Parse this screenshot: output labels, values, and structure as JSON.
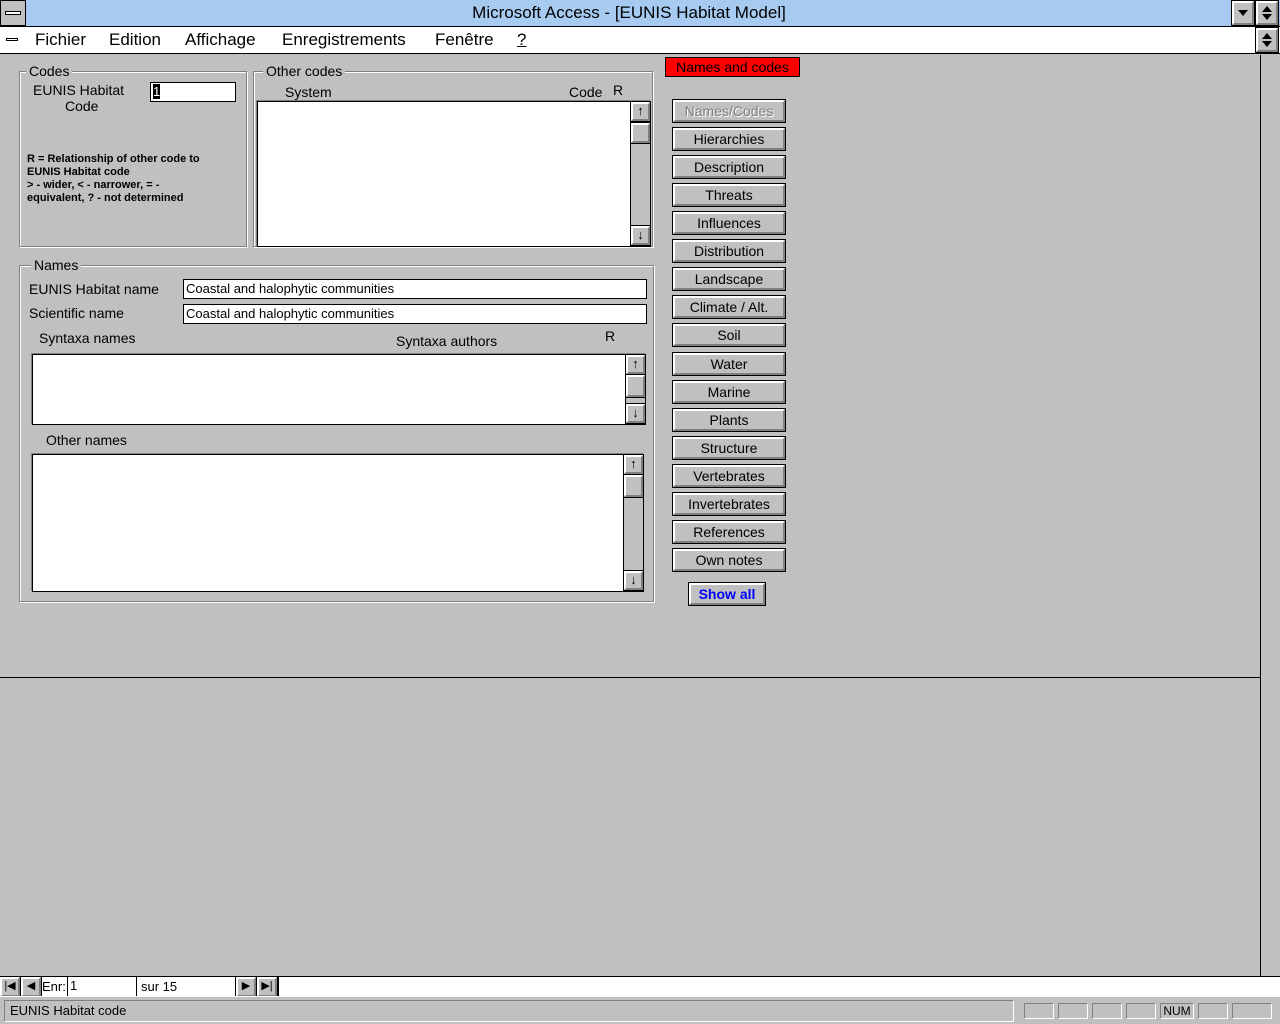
{
  "window": {
    "title": "Microsoft Access - [EUNIS Habitat Model]"
  },
  "menu": {
    "items": [
      "Fichier",
      "Edition",
      "Affichage",
      "Enregistrements",
      "Fenêtre",
      "?"
    ]
  },
  "codes": {
    "group_label": "Codes",
    "eunis_code_label_1": "EUNIS Habitat",
    "eunis_code_label_2": "Code",
    "eunis_code_value": "1",
    "help_line_1": "R = Relationship of other code to",
    "help_line_2": "EUNIS Habitat code",
    "help_line_3": "> - wider, < - narrower, = -",
    "help_line_4": "equivalent, ? - not determined"
  },
  "other_codes": {
    "group_label": "Other codes",
    "col_system": "System",
    "col_code": "Code",
    "col_r": "R"
  },
  "names": {
    "group_label": "Names",
    "eunis_name_label": "EUNIS Habitat name",
    "eunis_name_value": "Coastal and halophytic communities",
    "scientific_name_label": "Scientific name",
    "scientific_name_value": "Coastal and halophytic communities",
    "syntaxa_names_label": "Syntaxa names",
    "syntaxa_authors_label": "Syntaxa authors",
    "syntaxa_r_label": "R",
    "other_names_label": "Other names"
  },
  "badge": {
    "label": "Names and codes",
    "color": "#ff0000"
  },
  "nav_buttons": [
    {
      "label": "Names/Codes",
      "enabled": false
    },
    {
      "label": "Hierarchies",
      "enabled": true
    },
    {
      "label": "Description",
      "enabled": true
    },
    {
      "label": "Threats",
      "enabled": true
    },
    {
      "label": "Influences",
      "enabled": true
    },
    {
      "label": "Distribution",
      "enabled": true
    },
    {
      "label": "Landscape",
      "enabled": true
    },
    {
      "label": "Climate / Alt.",
      "enabled": true
    },
    {
      "label": "Soil",
      "enabled": true
    },
    {
      "label": "Water",
      "enabled": true
    },
    {
      "label": "Marine",
      "enabled": true
    },
    {
      "label": "Plants",
      "enabled": true
    },
    {
      "label": "Structure",
      "enabled": true
    },
    {
      "label": "Vertebrates",
      "enabled": true
    },
    {
      "label": "Invertebrates",
      "enabled": true
    },
    {
      "label": "References",
      "enabled": true
    },
    {
      "label": "Own notes",
      "enabled": true
    }
  ],
  "show_all": {
    "label": "Show all",
    "color": "#0000ff"
  },
  "record_nav": {
    "prefix": "Enr:",
    "current": "1",
    "total_text": "sur 15"
  },
  "status": {
    "text": "EUNIS Habitat code",
    "num_indicator": "NUM"
  },
  "icons": {
    "system_menu": "system-menu-icon",
    "restore": "restore-icon",
    "scroll_up": "arrow-up-icon",
    "scroll_down": "arrow-down-icon",
    "first_record": "first-record-icon",
    "prev_record": "prev-record-icon",
    "next_record": "next-record-icon",
    "last_record": "last-record-icon"
  }
}
